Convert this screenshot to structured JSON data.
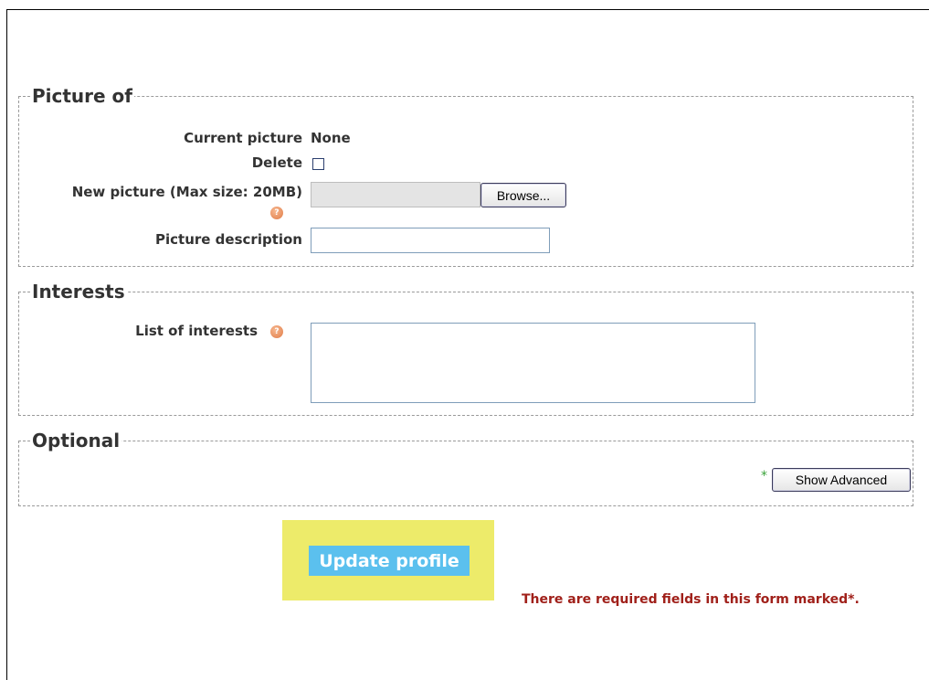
{
  "sections": {
    "picture": {
      "legend": "Picture of"
    },
    "interests": {
      "legend": "Interests"
    },
    "optional": {
      "legend": "Optional"
    }
  },
  "picture": {
    "current_label": "Current picture",
    "current_value": "None",
    "delete_label": "Delete",
    "delete_checked": false,
    "new_label": "New picture (Max size: 20MB)",
    "browse_label": "Browse...",
    "description_label": "Picture description",
    "description_value": ""
  },
  "interests": {
    "list_label": "List of interests",
    "list_value": ""
  },
  "optional": {
    "required_mark": "*",
    "show_advanced_label": "Show Advanced"
  },
  "actions": {
    "update_label": "Update profile",
    "required_note": "There are required fields in this form marked*."
  },
  "colors": {
    "highlight": "#edeb6a",
    "update_button": "#5bc0ee",
    "required_note": "#a0201a",
    "help_icon": "#e07c48"
  },
  "icons": {
    "help": "help-icon"
  }
}
